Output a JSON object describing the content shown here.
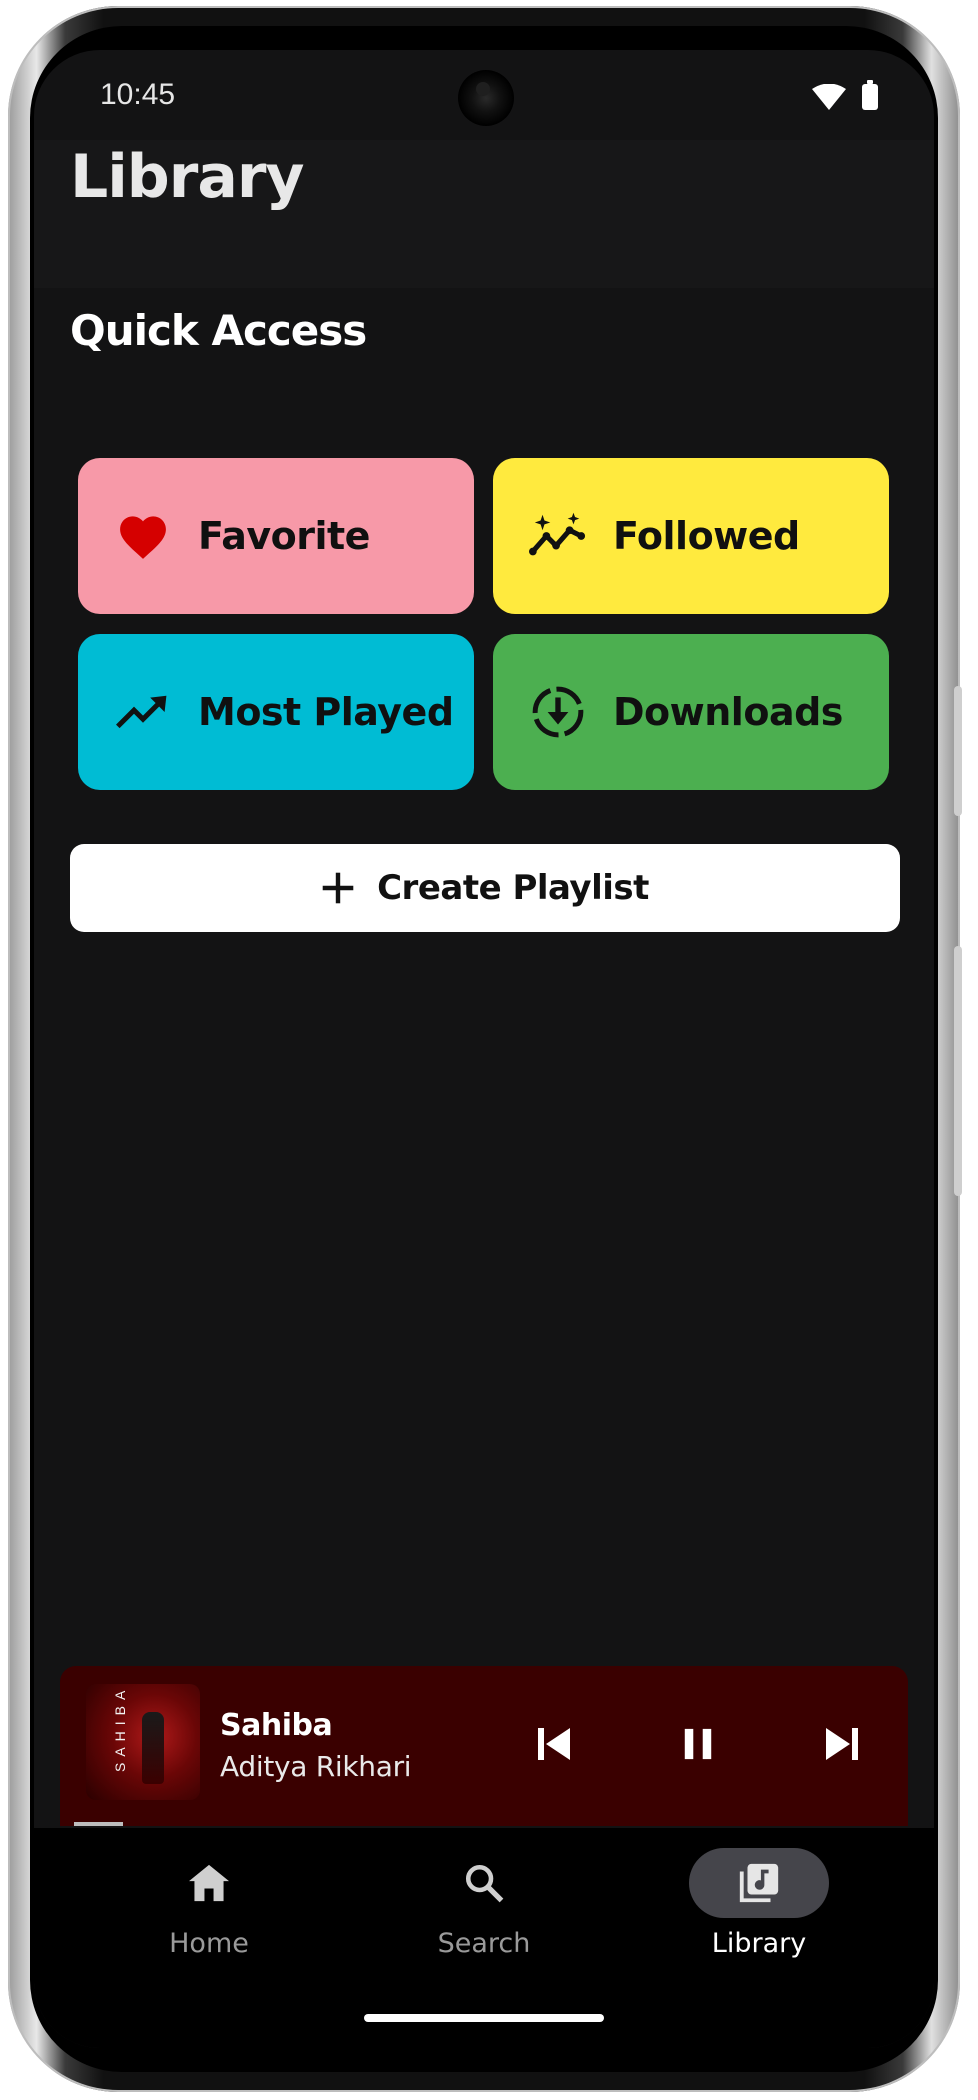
{
  "status_bar": {
    "time": "10:45"
  },
  "header": {
    "title": "Library"
  },
  "quick_access": {
    "title": "Quick Access",
    "tiles": [
      {
        "label": "Favorite",
        "icon": "heart-icon",
        "color": "#f799a8"
      },
      {
        "label": "Followed",
        "icon": "sparkle-trend-icon",
        "color": "#ffea3e"
      },
      {
        "label": "Most Played",
        "icon": "trending-up-icon",
        "color": "#00bcd4"
      },
      {
        "label": "Downloads",
        "icon": "download-circle-icon",
        "color": "#4caf50"
      }
    ]
  },
  "create_playlist": {
    "label": "Create Playlist",
    "icon": "plus-icon"
  },
  "mini_player": {
    "song_title": "Sahiba",
    "artist": "Aditya Rikhari",
    "album_art_text": "SAHIBA",
    "progress": 0.06,
    "background": "#3a0000"
  },
  "bottom_nav": {
    "items": [
      {
        "label": "Home",
        "icon": "home-icon",
        "active": false
      },
      {
        "label": "Search",
        "icon": "search-icon",
        "active": false
      },
      {
        "label": "Library",
        "icon": "library-music-icon",
        "active": true
      }
    ]
  }
}
